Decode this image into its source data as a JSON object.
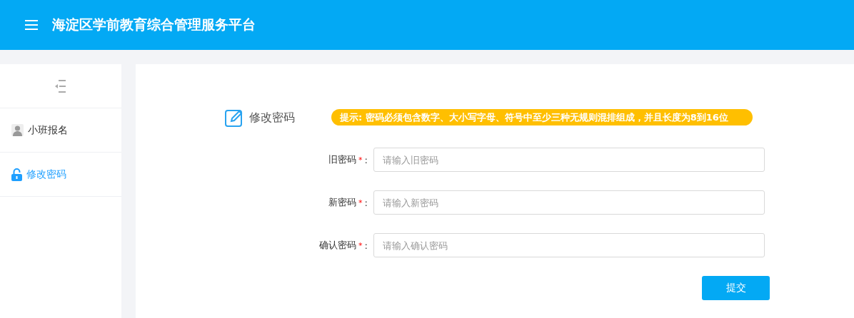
{
  "header": {
    "title": "海淀区学前教育综合管理服务平台"
  },
  "sidebar": {
    "items": [
      {
        "label": "小班报名",
        "selected": false
      },
      {
        "label": "修改密码",
        "selected": true
      }
    ]
  },
  "form": {
    "title": "修改密码",
    "hint": "提示: 密码必须包含数字、大小写字母、符号中至少三种无规则混排组成，并且长度为8到16位",
    "fields": [
      {
        "label": "旧密码",
        "required_mark": "*",
        "colon": ":",
        "placeholder": "请输入旧密码"
      },
      {
        "label": "新密码",
        "required_mark": "*",
        "colon": ":",
        "placeholder": "请输入新密码"
      },
      {
        "label": "确认密码",
        "required_mark": "*",
        "colon": ":",
        "placeholder": "请输入确认密码"
      }
    ],
    "submit": "提交"
  }
}
